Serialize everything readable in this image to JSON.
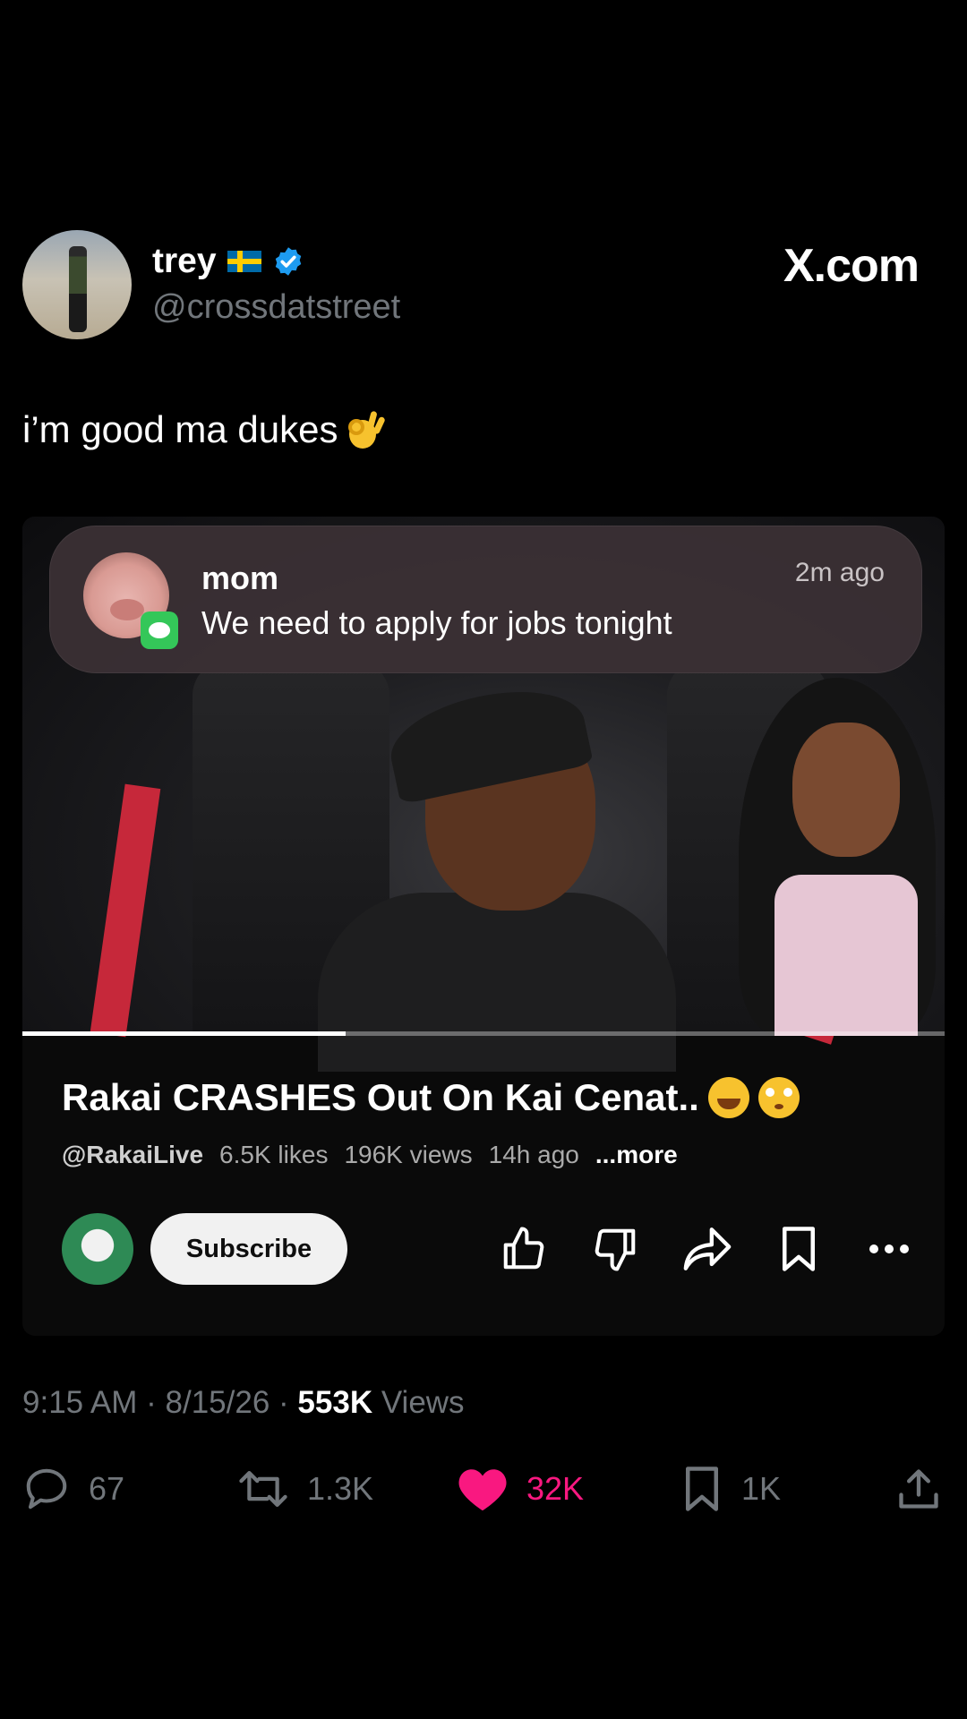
{
  "user": {
    "display_name": "trey",
    "flag": "🇸🇪",
    "handle": "@crossdatstreet",
    "verified": true
  },
  "brand": "X.com",
  "tweet_text": "i’m good ma dukes",
  "tweet_emoji": "ok-hand",
  "notification": {
    "sender": "mom",
    "message": "We need to apply for jobs tonight",
    "time": "2m ago",
    "app_icon": "messages-icon"
  },
  "video": {
    "title": "Rakai CRASHES Out On Kai Cenat..",
    "title_emojis": [
      "laughing-tears",
      "flushed"
    ],
    "channel": "@RakaiLive",
    "likes": "6.5K likes",
    "views": "196K views",
    "age": "14h ago",
    "more": "...more",
    "subscribe_label": "Subscribe",
    "progress": 0.35
  },
  "meta": {
    "time": "9:15 AM",
    "date": "8/15/26",
    "views_count": "553K",
    "views_label": "Views",
    "separator": " · "
  },
  "actions": {
    "replies": "67",
    "reposts": "1.3K",
    "likes": "32K",
    "bookmarks": "1K"
  },
  "colors": {
    "background": "#000000",
    "like_pink": "#f91880",
    "verified_blue": "#1d9bf0",
    "muted_gray": "#71767b"
  }
}
